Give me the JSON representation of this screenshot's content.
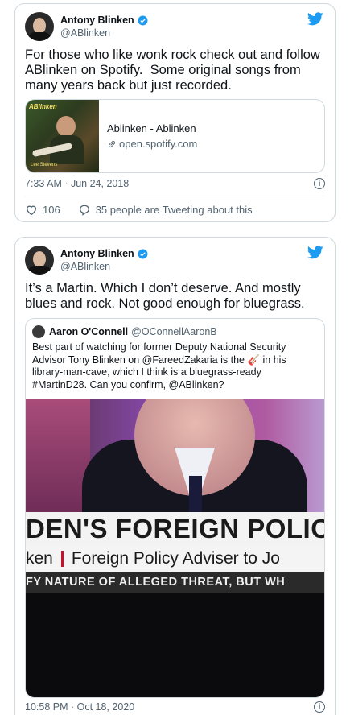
{
  "tweets": [
    {
      "author": {
        "name": "Antony Blinken",
        "handle": "@ABlinken"
      },
      "text": "For those who like wonk rock check out and follow ABlinken on Spotify.  Some original songs from many years back but just recorded.",
      "link_card": {
        "thumb_text": "ABlinken",
        "thumb_caption": "Lee Stevens",
        "title": "Ablinken - Ablinken",
        "domain": "open.spotify.com"
      },
      "timestamp": "7:33 AM · Jun 24, 2018",
      "likes": "106",
      "conversation": "35 people are Tweeting about this"
    },
    {
      "author": {
        "name": "Antony Blinken",
        "handle": "@ABlinken"
      },
      "text": "It’s a Martin. Which I don’t deserve. And mostly blues and rock. Not good enough for bluegrass.",
      "quote": {
        "author": "Aaron O'Connell",
        "handle": "@OConnellAaronB",
        "text_before": "Best part of watching for former Deputy National Security Advisor Tony Blinken on @FareedZakaria is the ",
        "emoji": "🎸",
        "text_after": " in his library-man-cave, which I think is a bluegrass-ready #MartinD28. Can you confirm, @ABlinken?",
        "image_text": {
          "headline": "DEN'S FOREIGN POLIC",
          "name_fragment": "ken",
          "title_line": "Foreign Policy Adviser to Jo",
          "ticker": "FY NATURE OF ALLEGED THREAT, BUT WH"
        }
      },
      "timestamp": "10:58 PM · Oct 18, 2020"
    }
  ],
  "colors": {
    "accent": "#1d9bf0",
    "muted": "#536471",
    "border": "#cfd9de"
  }
}
